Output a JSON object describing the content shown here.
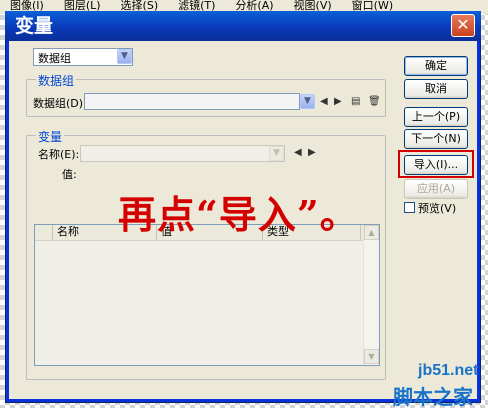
{
  "background_menu": [
    "图像(I)",
    "图层(L)",
    "选择(S)",
    "滤镜(T)",
    "分析(A)",
    "视图(V)",
    "窗口(W)"
  ],
  "dialog": {
    "title": "变量",
    "close_glyph": "✕",
    "top_select_value": "数据组",
    "dataset_group": {
      "title": "数据组",
      "label": "数据组(D):",
      "value": ""
    },
    "variable_group": {
      "title": "变量",
      "name_label": "名称(E):",
      "name_value": "",
      "value_label": "值:"
    },
    "table": {
      "columns": [
        "名称",
        "值",
        "类型"
      ],
      "rows": []
    },
    "buttons": {
      "ok": "确定",
      "cancel": "取消",
      "previous": "上一个(P)",
      "next": "下一个(N)",
      "import": "导入(I)...",
      "apply": "应用(A)"
    },
    "preview": {
      "label": "预览(V)",
      "checked": false
    }
  },
  "annotation": {
    "text": "再点“导入”。",
    "color": "#d40000"
  },
  "watermark": {
    "site": "jb51.net",
    "slogan": "脚本之家"
  },
  "colors": {
    "title_bar": "#0a3ab8",
    "dialog_face": "#ece9d8",
    "group_title": "#0046d5",
    "highlight": "#d20000"
  }
}
